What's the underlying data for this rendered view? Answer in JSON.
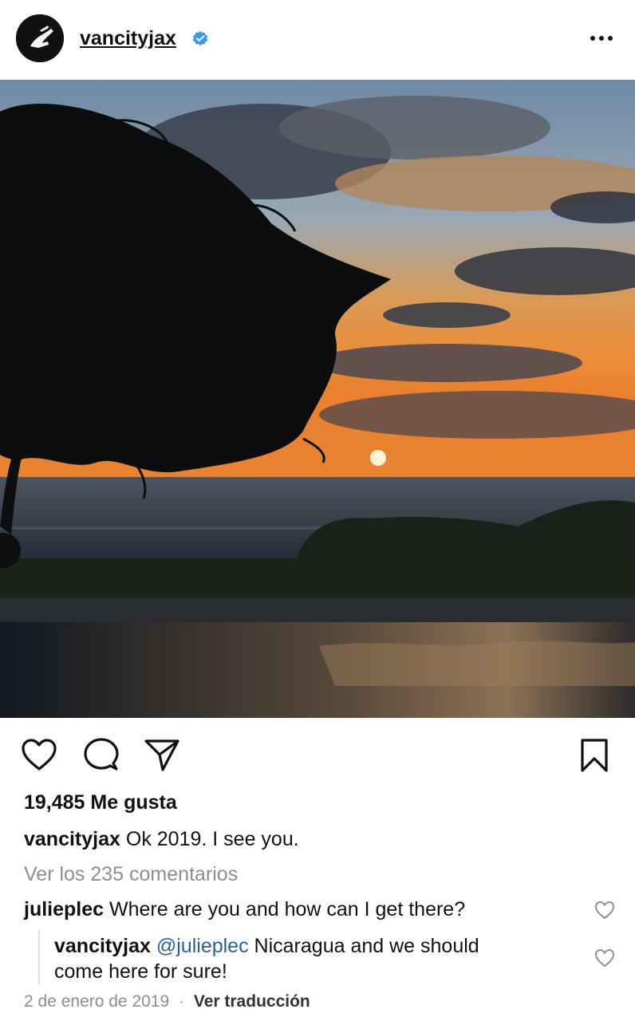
{
  "post": {
    "username": "vancityjax",
    "verified": true,
    "likes_text": "19,485 Me gusta",
    "caption": {
      "username": "vancityjax",
      "text": "Ok 2019. I see you."
    },
    "view_comments": "Ver los 235 comentarios",
    "comments": [
      {
        "username": "julieplec",
        "text": "Where are you and how can I get there?"
      },
      {
        "username": "vancityjax",
        "mention": "@julieplec",
        "text_line1": "Nicaragua and we should",
        "text_line2": "come here for sure!"
      }
    ],
    "date": "2 de enero de 2019",
    "separator": "·",
    "translate": "Ver traducción"
  },
  "icons": {
    "more": "more-options-icon",
    "like": "heart-icon",
    "comment": "comment-bubble-icon",
    "share": "paper-plane-icon",
    "save": "bookmark-icon",
    "verified": "verified-badge-icon"
  },
  "colors": {
    "verified_blue": "#3897f0",
    "muted_text": "#8e8e8e",
    "mention": "#2b5e9c"
  }
}
